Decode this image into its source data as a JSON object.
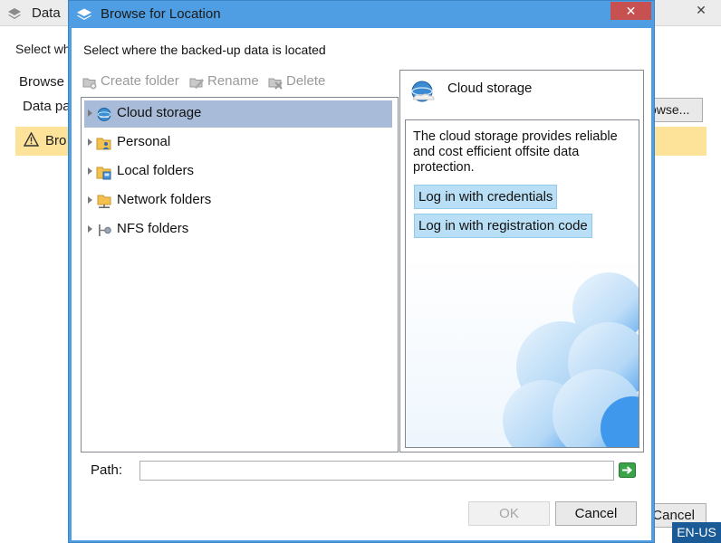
{
  "background_window": {
    "title": "Data",
    "close_glyph": "✕",
    "instruction": "Select wh",
    "browse_label": "Browse",
    "data_path_label": "Data pa",
    "browse_button": "owse...",
    "warning_text": "Bro",
    "cancel_button": "Cancel",
    "language": "EN-US"
  },
  "dialog": {
    "title": "Browse for Location",
    "close_glyph": "✕",
    "instruction": "Select where the backed-up data is located",
    "toolbar": {
      "create_folder": "Create folder",
      "rename": "Rename",
      "delete": "Delete"
    },
    "tree": [
      {
        "label": "Cloud storage",
        "icon": "cloud-storage-icon",
        "selected": true
      },
      {
        "label": "Personal",
        "icon": "personal-folder-icon",
        "selected": false
      },
      {
        "label": "Local folders",
        "icon": "local-folders-icon",
        "selected": false
      },
      {
        "label": "Network folders",
        "icon": "network-folders-icon",
        "selected": false
      },
      {
        "label": "NFS folders",
        "icon": "nfs-folders-icon",
        "selected": false
      }
    ],
    "info": {
      "title": "Cloud storage",
      "description": "The cloud storage provides reliable and cost efficient offsite data protection.",
      "login_credentials": "Log in with credentials",
      "login_registration": "Log in with registration code"
    },
    "path": {
      "label": "Path:",
      "value": ""
    },
    "ok_button": "OK",
    "cancel_button": "Cancel"
  },
  "colors": {
    "dialog_frame": "#4f9ee3",
    "close_button": "#c75050",
    "selection": "#a8bcd9",
    "login_button": "#b9dff6",
    "warning_bar": "#fde29a",
    "language_indicator": "#1a5a96"
  }
}
